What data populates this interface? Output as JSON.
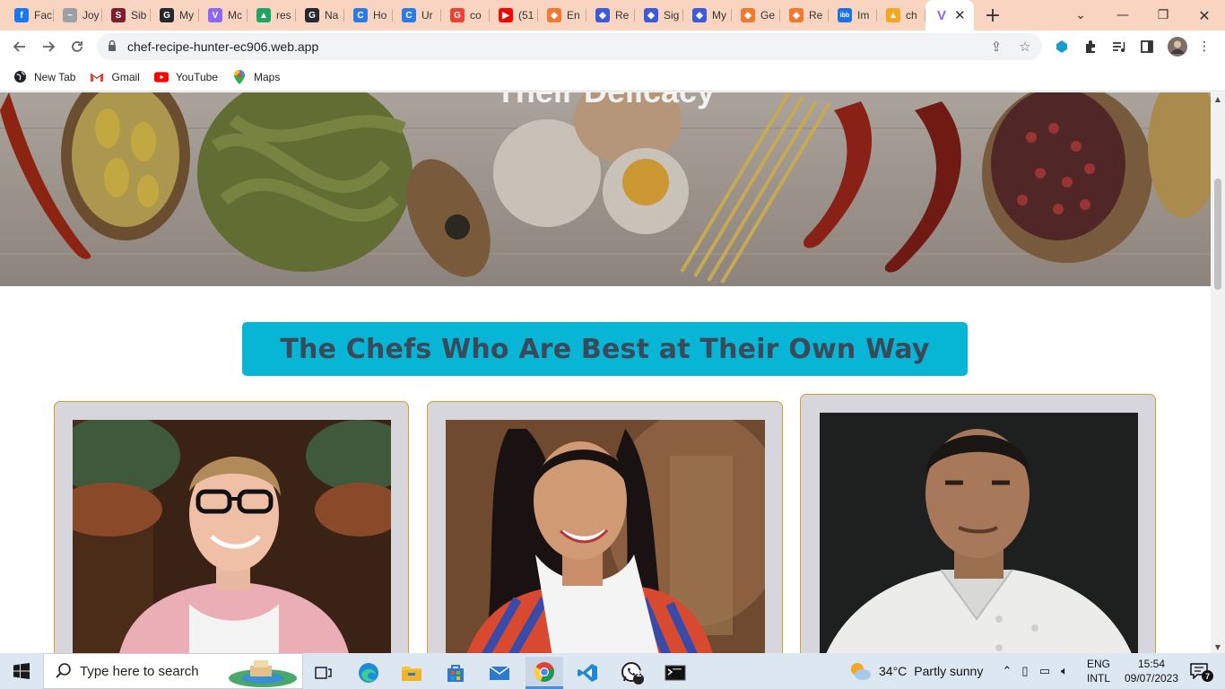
{
  "browser": {
    "tabs": [
      {
        "title": "Fac",
        "icon": "facebook-icon",
        "color": "#1877f2",
        "glyph": "f"
      },
      {
        "title": "Joy",
        "icon": "bird-icon",
        "color": "#9aa0a6",
        "glyph": "~"
      },
      {
        "title": "Sib",
        "icon": "image-icon",
        "color": "#7a1f2b",
        "glyph": "S"
      },
      {
        "title": "My",
        "icon": "github-icon",
        "color": "#24292f",
        "glyph": "G"
      },
      {
        "title": "Mc",
        "icon": "vite-icon",
        "color": "#8a67f5",
        "glyph": "V"
      },
      {
        "title": "res",
        "icon": "google-drive-icon",
        "color": "#1fa463",
        "glyph": "▲"
      },
      {
        "title": "Na",
        "icon": "github-icon",
        "color": "#24292f",
        "glyph": "G"
      },
      {
        "title": "Ho",
        "icon": "copilot-icon",
        "color": "#2c7be5",
        "glyph": "C"
      },
      {
        "title": "Ur",
        "icon": "copilot-icon",
        "color": "#2c7be5",
        "glyph": "C"
      },
      {
        "title": "co",
        "icon": "google-icon",
        "color": "#ea4335",
        "glyph": "G"
      },
      {
        "title": "(51",
        "icon": "youtube-icon",
        "color": "#ff0000",
        "glyph": "▶"
      },
      {
        "title": "En",
        "icon": "bookmark-icon",
        "color": "#f07a30",
        "glyph": "◆"
      },
      {
        "title": "Re",
        "icon": "shield-icon",
        "color": "#3b5bdb",
        "glyph": "◆"
      },
      {
        "title": "Sig",
        "icon": "shield-icon",
        "color": "#3b5bdb",
        "glyph": "◆"
      },
      {
        "title": "My",
        "icon": "shield-icon",
        "color": "#3b5bdb",
        "glyph": "◆"
      },
      {
        "title": "Ge",
        "icon": "bookmark-icon",
        "color": "#f07a30",
        "glyph": "◆"
      },
      {
        "title": "Re",
        "icon": "bookmark-icon",
        "color": "#f07a30",
        "glyph": "◆"
      },
      {
        "title": "Im",
        "icon": "imgbb-icon",
        "color": "#1a73e8",
        "glyph": "ibb"
      },
      {
        "title": "ch",
        "icon": "firebase-icon",
        "color": "#f5a623",
        "glyph": "▲"
      }
    ],
    "active_tab": {
      "icon": "vite-icon",
      "color": "#8a67f5",
      "glyph": "V",
      "close": "✕"
    },
    "new_tab": "+",
    "window_controls": {
      "dropdown": "⌄",
      "minimize": "—",
      "restore": "❐",
      "close": "✕"
    },
    "url": "chef-recipe-hunter-ec906.web.app",
    "bookmarks": [
      {
        "label": "New Tab",
        "icon": "globe-icon"
      },
      {
        "label": "Gmail",
        "icon": "gmail-icon"
      },
      {
        "label": "YouTube",
        "icon": "youtube-icon"
      },
      {
        "label": "Maps",
        "icon": "maps-icon"
      }
    ]
  },
  "page": {
    "hero_title": "Their Delicacy",
    "section_heading": "The Chefs Who Are Best at Their Own Way",
    "chefs": [
      {
        "photo": "chef-photo-glasses-pink-shirt"
      },
      {
        "photo": "chef-photo-woman-striped-top"
      },
      {
        "photo": "chef-photo-white-chef-jacket"
      }
    ]
  },
  "taskbar": {
    "search_placeholder": "Type here to search",
    "apps": [
      "task-view-icon",
      "edge-icon",
      "file-explorer-icon",
      "store-icon",
      "mail-icon",
      "chrome-icon",
      "vscode-icon",
      "whatsapp-icon",
      "terminal-icon"
    ],
    "whatsapp_badge": "2",
    "weather_temp": "34°C",
    "weather_desc": "Partly sunny",
    "lang": "ENG",
    "lang_sub": "INTL",
    "time": "15:54",
    "date": "09/07/2023",
    "notification_count": "7"
  },
  "colors": {
    "tabstrip": "#f9d5c1",
    "heading_bg": "#06b6d4",
    "heading_text": "#3a4a5a",
    "card_bg": "#d7d6dc",
    "card_border": "#d99c2b"
  }
}
